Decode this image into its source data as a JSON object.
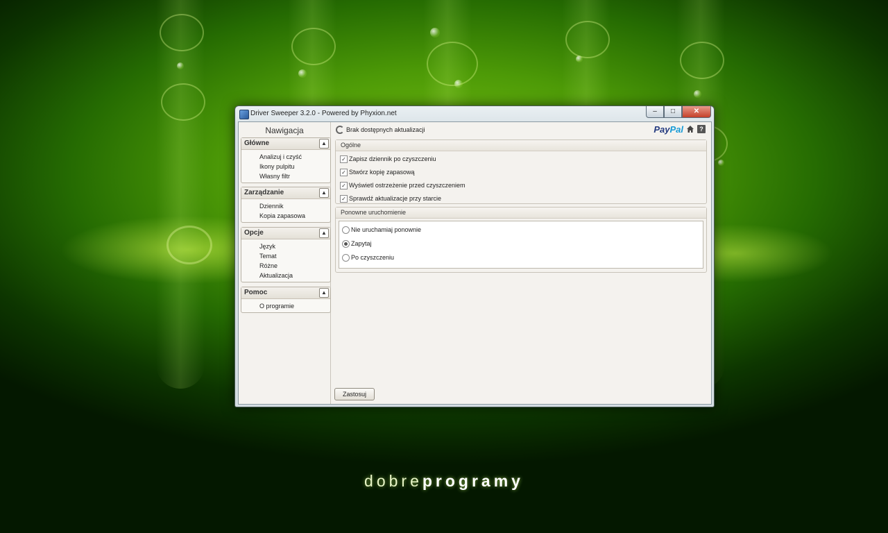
{
  "window": {
    "title": "Driver Sweeper 3.2.0 - Powered by Phyxion.net",
    "controls": {
      "minimize": "‒",
      "maximize": "□",
      "close": "✕"
    }
  },
  "nav": {
    "title": "Nawigacja",
    "groups": [
      {
        "label": "Główne",
        "items": [
          "Analizuj i czyść",
          "Ikony pulpitu",
          "Własny filtr"
        ]
      },
      {
        "label": "Zarządzanie",
        "items": [
          "Dziennik",
          "Kopia zapasowa"
        ]
      },
      {
        "label": "Opcje",
        "items": [
          "Język",
          "Temat",
          "Różne",
          "Aktualizacja"
        ]
      },
      {
        "label": "Pomoc",
        "items": [
          "O programie"
        ]
      }
    ]
  },
  "topbar": {
    "status": "Brak dostępnych aktualizacji",
    "paypal_a": "Pay",
    "paypal_b": "Pal",
    "help": "?"
  },
  "general": {
    "title": "Ogólne",
    "options": [
      {
        "label": "Zapisz dziennik po czyszczeniu",
        "checked": true
      },
      {
        "label": "Stwórz kopię zapasową",
        "checked": true
      },
      {
        "label": "Wyświetl ostrzeżenie przed czyszczeniem",
        "checked": true
      },
      {
        "label": "Sprawdź aktualizacje przy starcie",
        "checked": true
      }
    ]
  },
  "restart": {
    "title": "Ponowne uruchomienie",
    "options": [
      {
        "label": "Nie uruchamiaj ponownie",
        "selected": false
      },
      {
        "label": "Zapytaj",
        "selected": true
      },
      {
        "label": "Po czyszczeniu",
        "selected": false
      }
    ]
  },
  "apply_label": "Zastosuj",
  "branding": {
    "light": "dobre",
    "bold": "programy"
  },
  "colors": {
    "background": "#4d9a07",
    "paypal_dark": "#253b80",
    "paypal_light": "#179bd7"
  }
}
